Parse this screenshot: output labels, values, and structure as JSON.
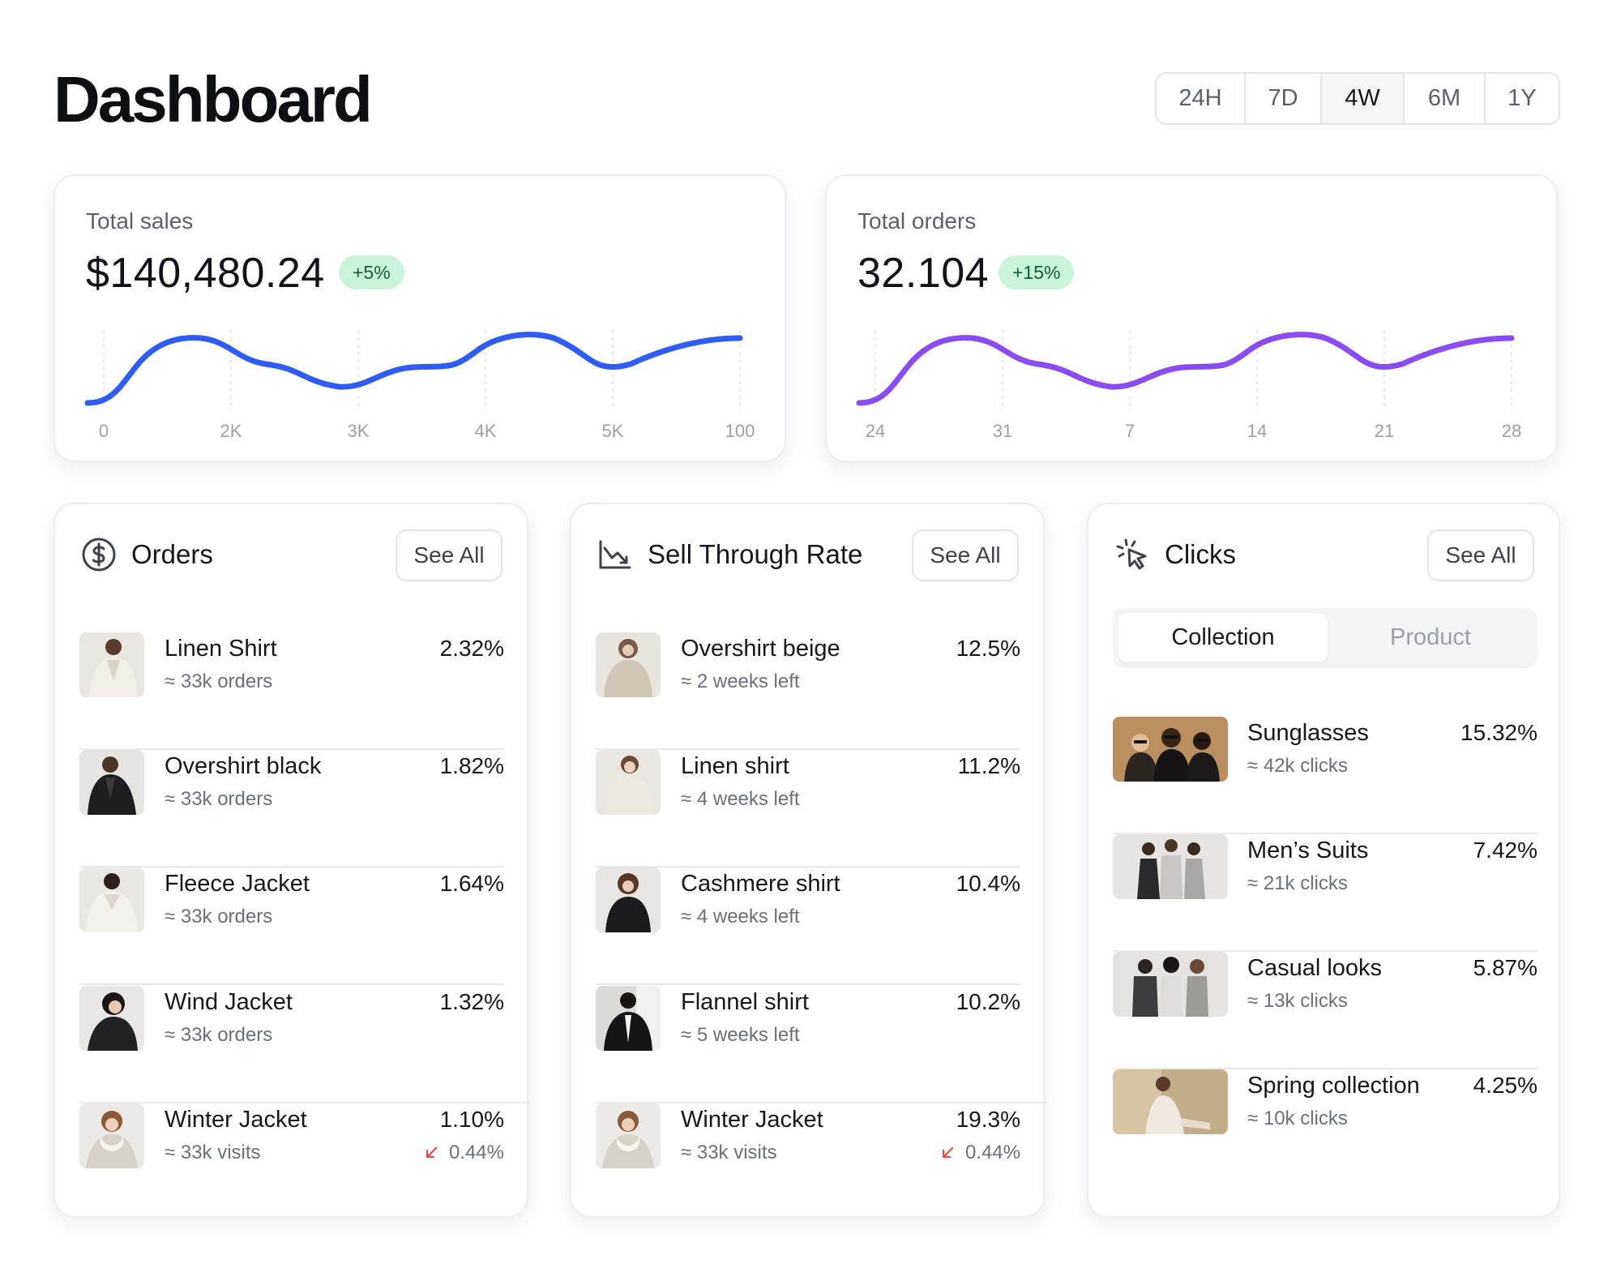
{
  "header": {
    "title": "Dashboard",
    "ranges": [
      "24H",
      "7D",
      "4W",
      "6M",
      "1Y"
    ],
    "active_range": "4W"
  },
  "kpis": [
    {
      "label": "Total sales",
      "value": "$140,480.24",
      "change": "+5%",
      "x_labels": [
        "0",
        "2K",
        "3K",
        "4K",
        "5K",
        "100"
      ],
      "line_color": "#2f5cf5"
    },
    {
      "label": "Total orders",
      "value": "32.104",
      "change": "+15%",
      "x_labels": [
        "24",
        "31",
        "7",
        "14",
        "21",
        "28"
      ],
      "line_color": "#8a4cf0"
    }
  ],
  "orders": {
    "title": "Orders",
    "see_all": "See All",
    "items": [
      {
        "name": "Linen Shirt",
        "sub": "≈ 33k orders",
        "value": "2.32%"
      },
      {
        "name": "Overshirt black",
        "sub": "≈ 33k orders",
        "value": "1.82%"
      },
      {
        "name": "Fleece Jacket",
        "sub": "≈ 33k orders",
        "value": "1.64%"
      },
      {
        "name": "Wind Jacket",
        "sub": "≈ 33k orders",
        "value": "1.32%"
      },
      {
        "name": "Winter Jacket",
        "sub": "≈ 33k visits",
        "value": "1.10%",
        "change": "0.44%"
      }
    ]
  },
  "sell_through": {
    "title": "Sell Through Rate",
    "see_all": "See All",
    "items": [
      {
        "name": "Overshirt beige",
        "sub": "≈ 2 weeks left",
        "value": "12.5%"
      },
      {
        "name": "Linen shirt",
        "sub": "≈ 4 weeks left",
        "value": "11.2%"
      },
      {
        "name": "Cashmere shirt",
        "sub": "≈ 4 weeks left",
        "value": "10.4%"
      },
      {
        "name": "Flannel shirt",
        "sub": "≈ 5 weeks left",
        "value": "10.2%"
      },
      {
        "name": "Winter Jacket",
        "sub": "≈ 33k visits",
        "value": "19.3%",
        "change": "0.44%"
      }
    ]
  },
  "clicks": {
    "title": "Clicks",
    "see_all": "See All",
    "tabs": [
      "Collection",
      "Product"
    ],
    "active_tab": "Collection",
    "items": [
      {
        "name": "Sunglasses",
        "sub": "≈ 42k clicks",
        "value": "15.32%"
      },
      {
        "name": "Men’s Suits",
        "sub": "≈ 21k clicks",
        "value": "7.42%"
      },
      {
        "name": "Casual looks",
        "sub": "≈ 13k clicks",
        "value": "5.87%"
      },
      {
        "name": "Spring collection",
        "sub": "≈ 10k clicks",
        "value": "4.25%"
      }
    ]
  },
  "colors": {
    "badge_bg": "#c9f3da",
    "badge_text": "#11612e",
    "down": "#e5484d"
  }
}
